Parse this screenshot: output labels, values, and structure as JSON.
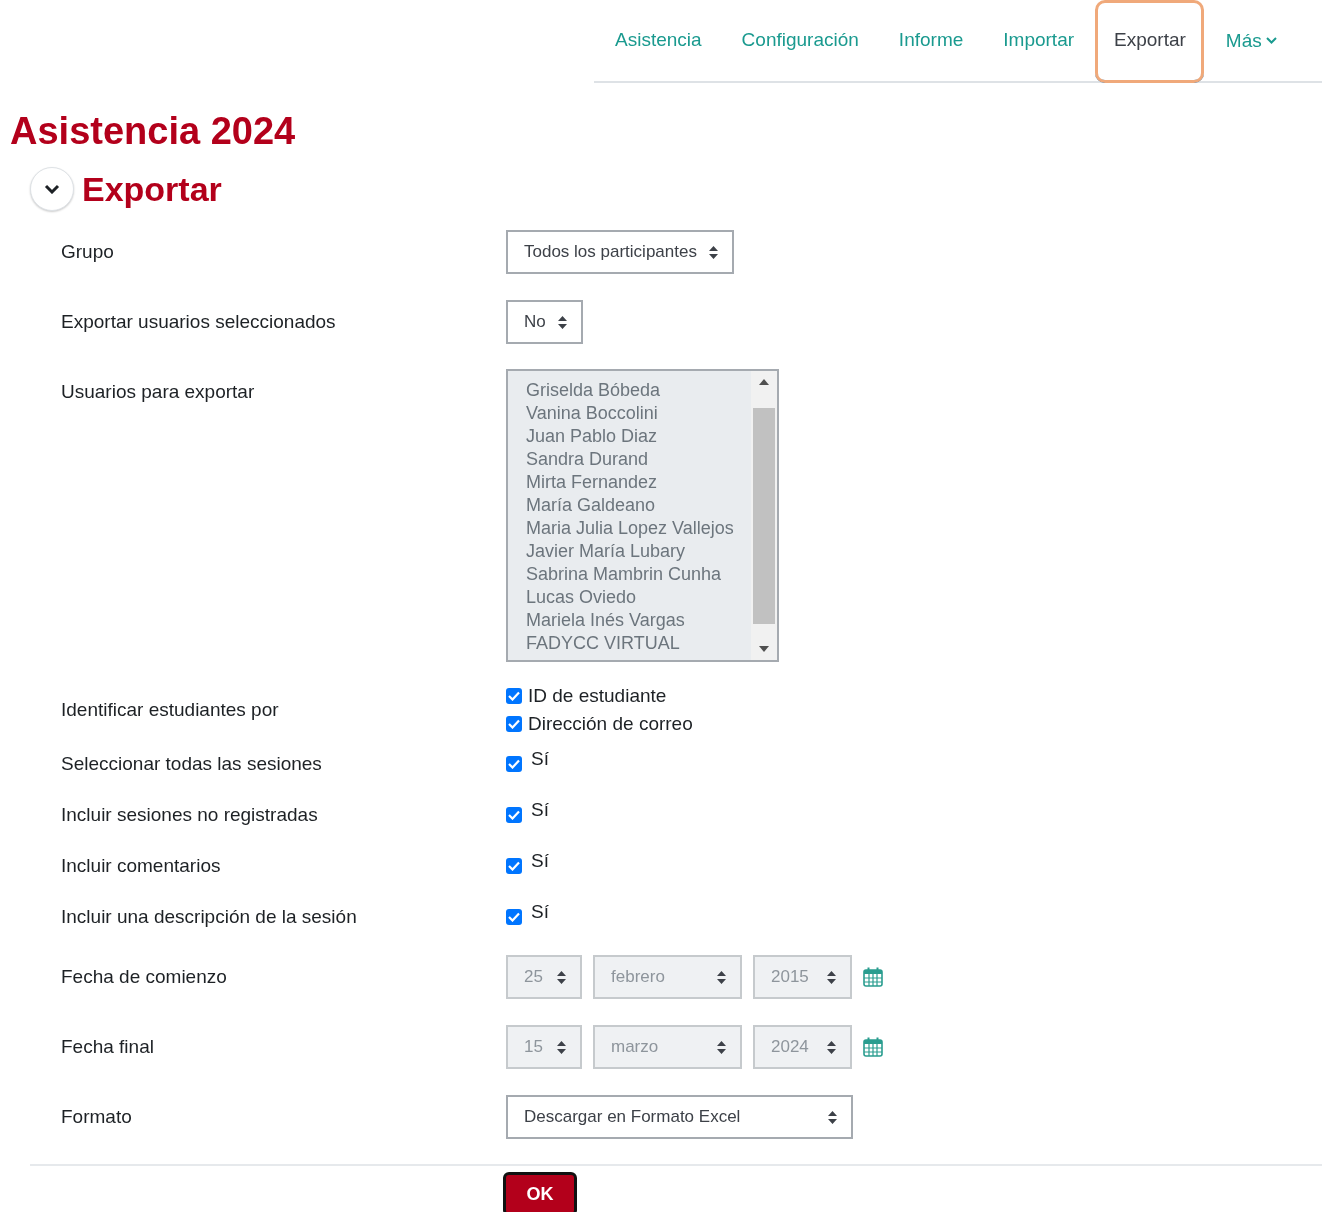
{
  "nav": {
    "tabs": [
      {
        "label": "Asistencia",
        "selected": false,
        "highlighted": false
      },
      {
        "label": "Configuración",
        "selected": false,
        "highlighted": false
      },
      {
        "label": "Informe",
        "selected": false,
        "highlighted": false
      },
      {
        "label": "Importar",
        "selected": false,
        "highlighted": false
      },
      {
        "label": "Exportar",
        "selected": true,
        "highlighted": true
      }
    ],
    "more": {
      "label": "Más"
    }
  },
  "title": "Asistencia 2024",
  "section": {
    "title": "Exportar",
    "expanded": true
  },
  "form": {
    "fields": [
      {
        "kind": "select",
        "label": "Grupo",
        "value": "Todos los participantes",
        "wide": false
      },
      {
        "kind": "select",
        "label": "Exportar usuarios seleccionados",
        "value": "No",
        "wide": false
      },
      {
        "kind": "listbox",
        "label": "Usuarios para exportar",
        "disabled": true,
        "options": [
          "Griselda Bóbeda",
          "Vanina Boccolini",
          "Juan Pablo Diaz",
          "Sandra Durand",
          "Mirta Fernandez",
          "María Galdeano",
          "Maria Julia Lopez Vallejos",
          "Javier María Lubary",
          "Sabrina Mambrin Cunha",
          "Lucas Oviedo",
          "Mariela Inés Vargas",
          "FADYCC VIRTUAL"
        ]
      },
      {
        "kind": "checkboxes",
        "label": "Identificar estudiantes por",
        "options": [
          {
            "label": "ID de estudiante",
            "checked": true
          },
          {
            "label": "Dirección de correo",
            "checked": true
          }
        ]
      },
      {
        "kind": "checkbox",
        "label": "Seleccionar todas las sesiones",
        "option": {
          "label": "Sí",
          "checked": true
        }
      },
      {
        "kind": "checkbox",
        "label": "Incluir sesiones no registradas",
        "option": {
          "label": "Sí",
          "checked": true
        }
      },
      {
        "kind": "checkbox",
        "label": "Incluir comentarios",
        "option": {
          "label": "Sí",
          "checked": true
        }
      },
      {
        "kind": "checkbox",
        "label": "Incluir una descripción de la sesión",
        "option": {
          "label": "Sí",
          "checked": true
        }
      },
      {
        "kind": "date",
        "label": "Fecha de comienzo",
        "disabled": true,
        "day": "25",
        "month": "febrero",
        "year": "2015"
      },
      {
        "kind": "date",
        "label": "Fecha final",
        "disabled": true,
        "day": "15",
        "month": "marzo",
        "year": "2024"
      },
      {
        "kind": "select",
        "label": "Formato",
        "value": "Descargar en Formato Excel",
        "wide": true
      }
    ]
  },
  "submit": {
    "label": "OK"
  }
}
